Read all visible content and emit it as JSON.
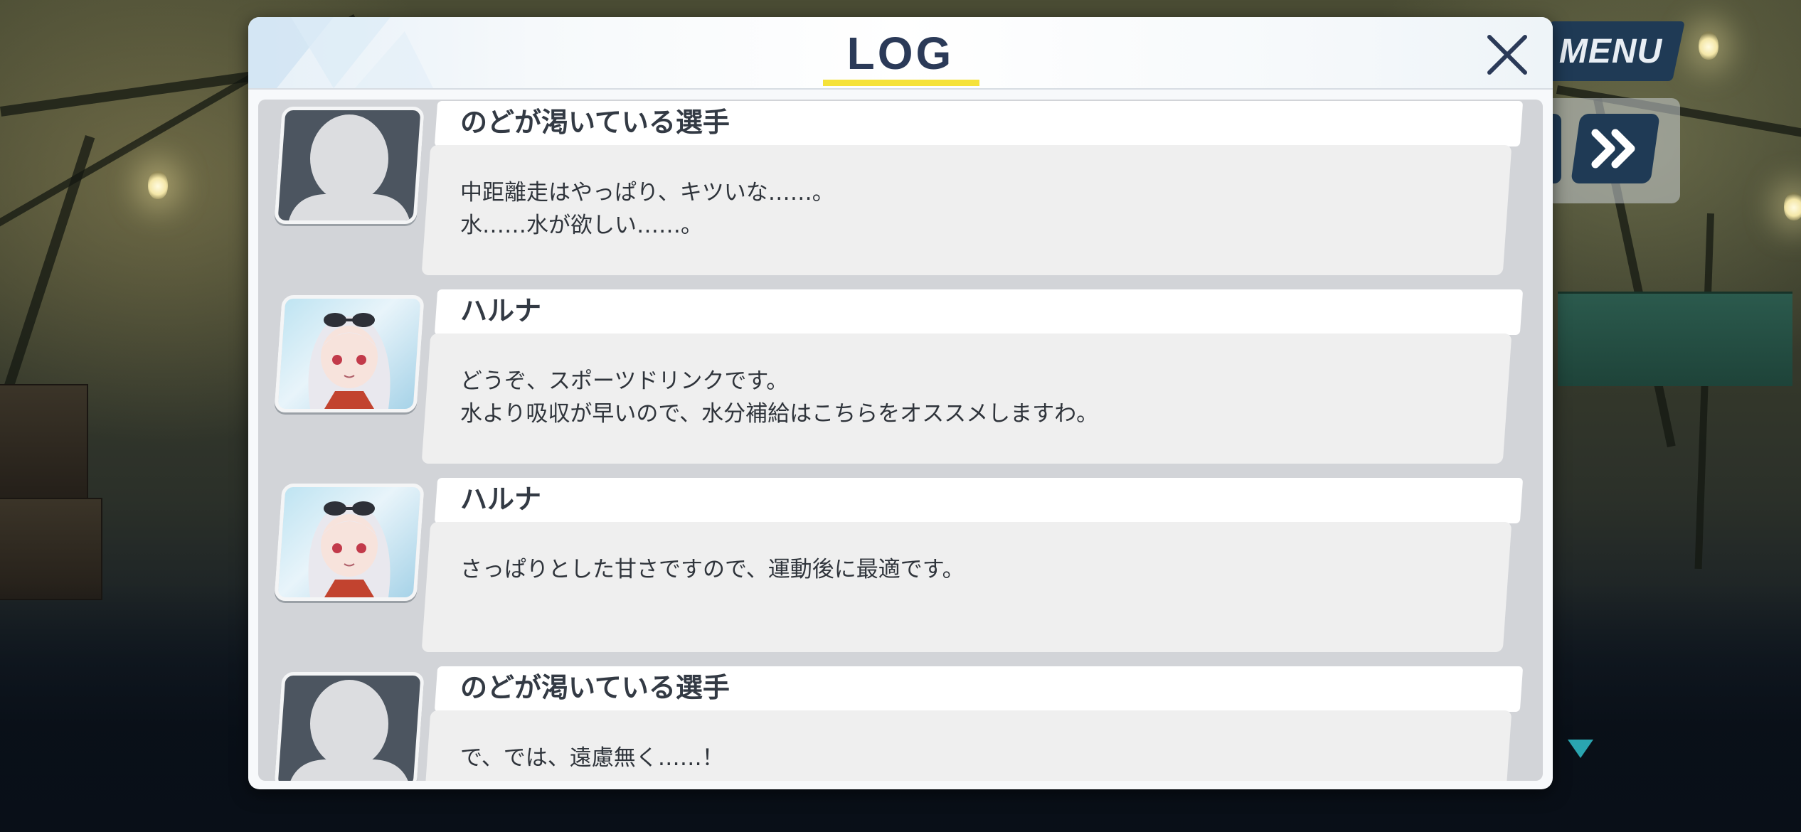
{
  "hud": {
    "menu_label": "MENU",
    "skip_icon": "fast-forward-icon",
    "scroll_icon": "triangle-down-icon"
  },
  "panel": {
    "title": "LOG",
    "close_icon": "close-icon",
    "accent_color": "#f5e23a",
    "title_color": "#2b3a58"
  },
  "log": [
    {
      "speaker": "のどが渇いている選手",
      "avatar": "silhouette-avatar",
      "lines": [
        "中距離走はやっぱり、キツいな……。",
        "水……水が欲しい……。"
      ]
    },
    {
      "speaker": "ハルナ",
      "avatar": "haruna-avatar",
      "lines": [
        "どうぞ、スポーツドリンクです。",
        "水より吸収が早いので、水分補給はこちらをオススメしますわ。"
      ]
    },
    {
      "speaker": "ハルナ",
      "avatar": "haruna-avatar",
      "lines": [
        "さっぱりとした甘さですので、運動後に最適です。"
      ]
    },
    {
      "speaker": "のどが渇いている選手",
      "avatar": "silhouette-avatar",
      "lines": [
        "で、では、遠慮無く……！"
      ]
    }
  ]
}
